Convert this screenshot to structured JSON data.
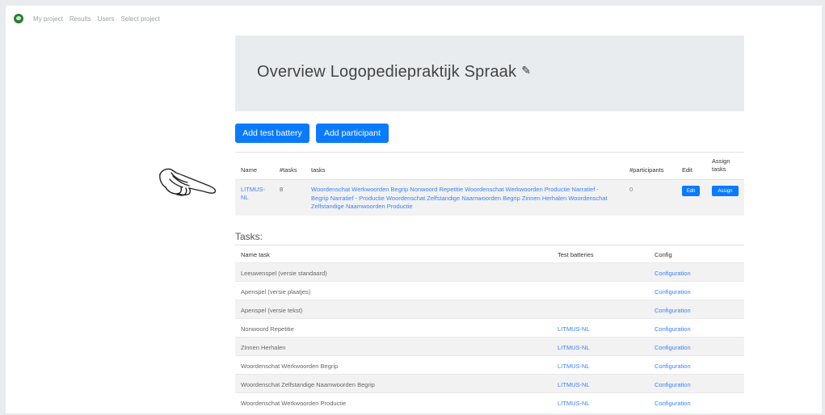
{
  "nav": {
    "items": [
      "My project",
      "Results",
      "Users",
      "Select project"
    ]
  },
  "header": {
    "title": "Overview Logopediepraktijk Spraak"
  },
  "actions": {
    "add_battery": "Add test battery",
    "add_participant": "Add participant"
  },
  "batteries": {
    "columns": {
      "name": "Name",
      "tasks_count": "#tasks",
      "tasks": "tasks",
      "participants": "#participants",
      "edit": "Edit",
      "assign": "Assign tasks"
    },
    "rows": [
      {
        "name": "LITMUS-NL",
        "tasks_count": "8",
        "tasks": "Woordenschat Werkwoorden Begrip Nonwoord Repetitie Woordenschat Werkwoorden Productie Narratief - Begrip Narratief - Productie Woordenschat Zelfstandige Naamwoorden Begrip Zinnen Herhalen Woordenschat Zelfstandige Naamwoorden Productie",
        "participants": "0",
        "edit_label": "Edit",
        "assign_label": "Assign"
      }
    ]
  },
  "tasks": {
    "title": "Tasks:",
    "columns": {
      "name": "Name task",
      "batteries": "Test batteries",
      "config": "Config"
    },
    "rows": [
      {
        "name": "Leeuwenspel (versie standaard)",
        "battery": "",
        "config": "Configuration"
      },
      {
        "name": "Apenspel (versie plaatjes)",
        "battery": "",
        "config": "Configuration"
      },
      {
        "name": "Apenspel (versie tekst)",
        "battery": "",
        "config": "Configuration"
      },
      {
        "name": "Nonwoord Repetitie",
        "battery": "LITMUS-NL",
        "config": "Configuration"
      },
      {
        "name": "Zinnen Herhalen",
        "battery": "LITMUS-NL",
        "config": "Configuration"
      },
      {
        "name": "Woordenschat Werkwoorden Begrip",
        "battery": "LITMUS-NL",
        "config": "Configuration"
      },
      {
        "name": "Woordenschat Zelfstandige Naamwoorden Begrip",
        "battery": "LITMUS-NL",
        "config": "Configuration"
      },
      {
        "name": "Woordenschat Werkwoorden Productie",
        "battery": "LITMUS-NL",
        "config": "Configuration"
      }
    ]
  },
  "colors": {
    "primary": "#0a7bff",
    "link": "#3b82f6",
    "jumbotron": "#e9ecef",
    "logo": "#2e7d32"
  },
  "icons": [
    "app-logo-icon",
    "pencil-icon",
    "pointing-hand-icon"
  ]
}
